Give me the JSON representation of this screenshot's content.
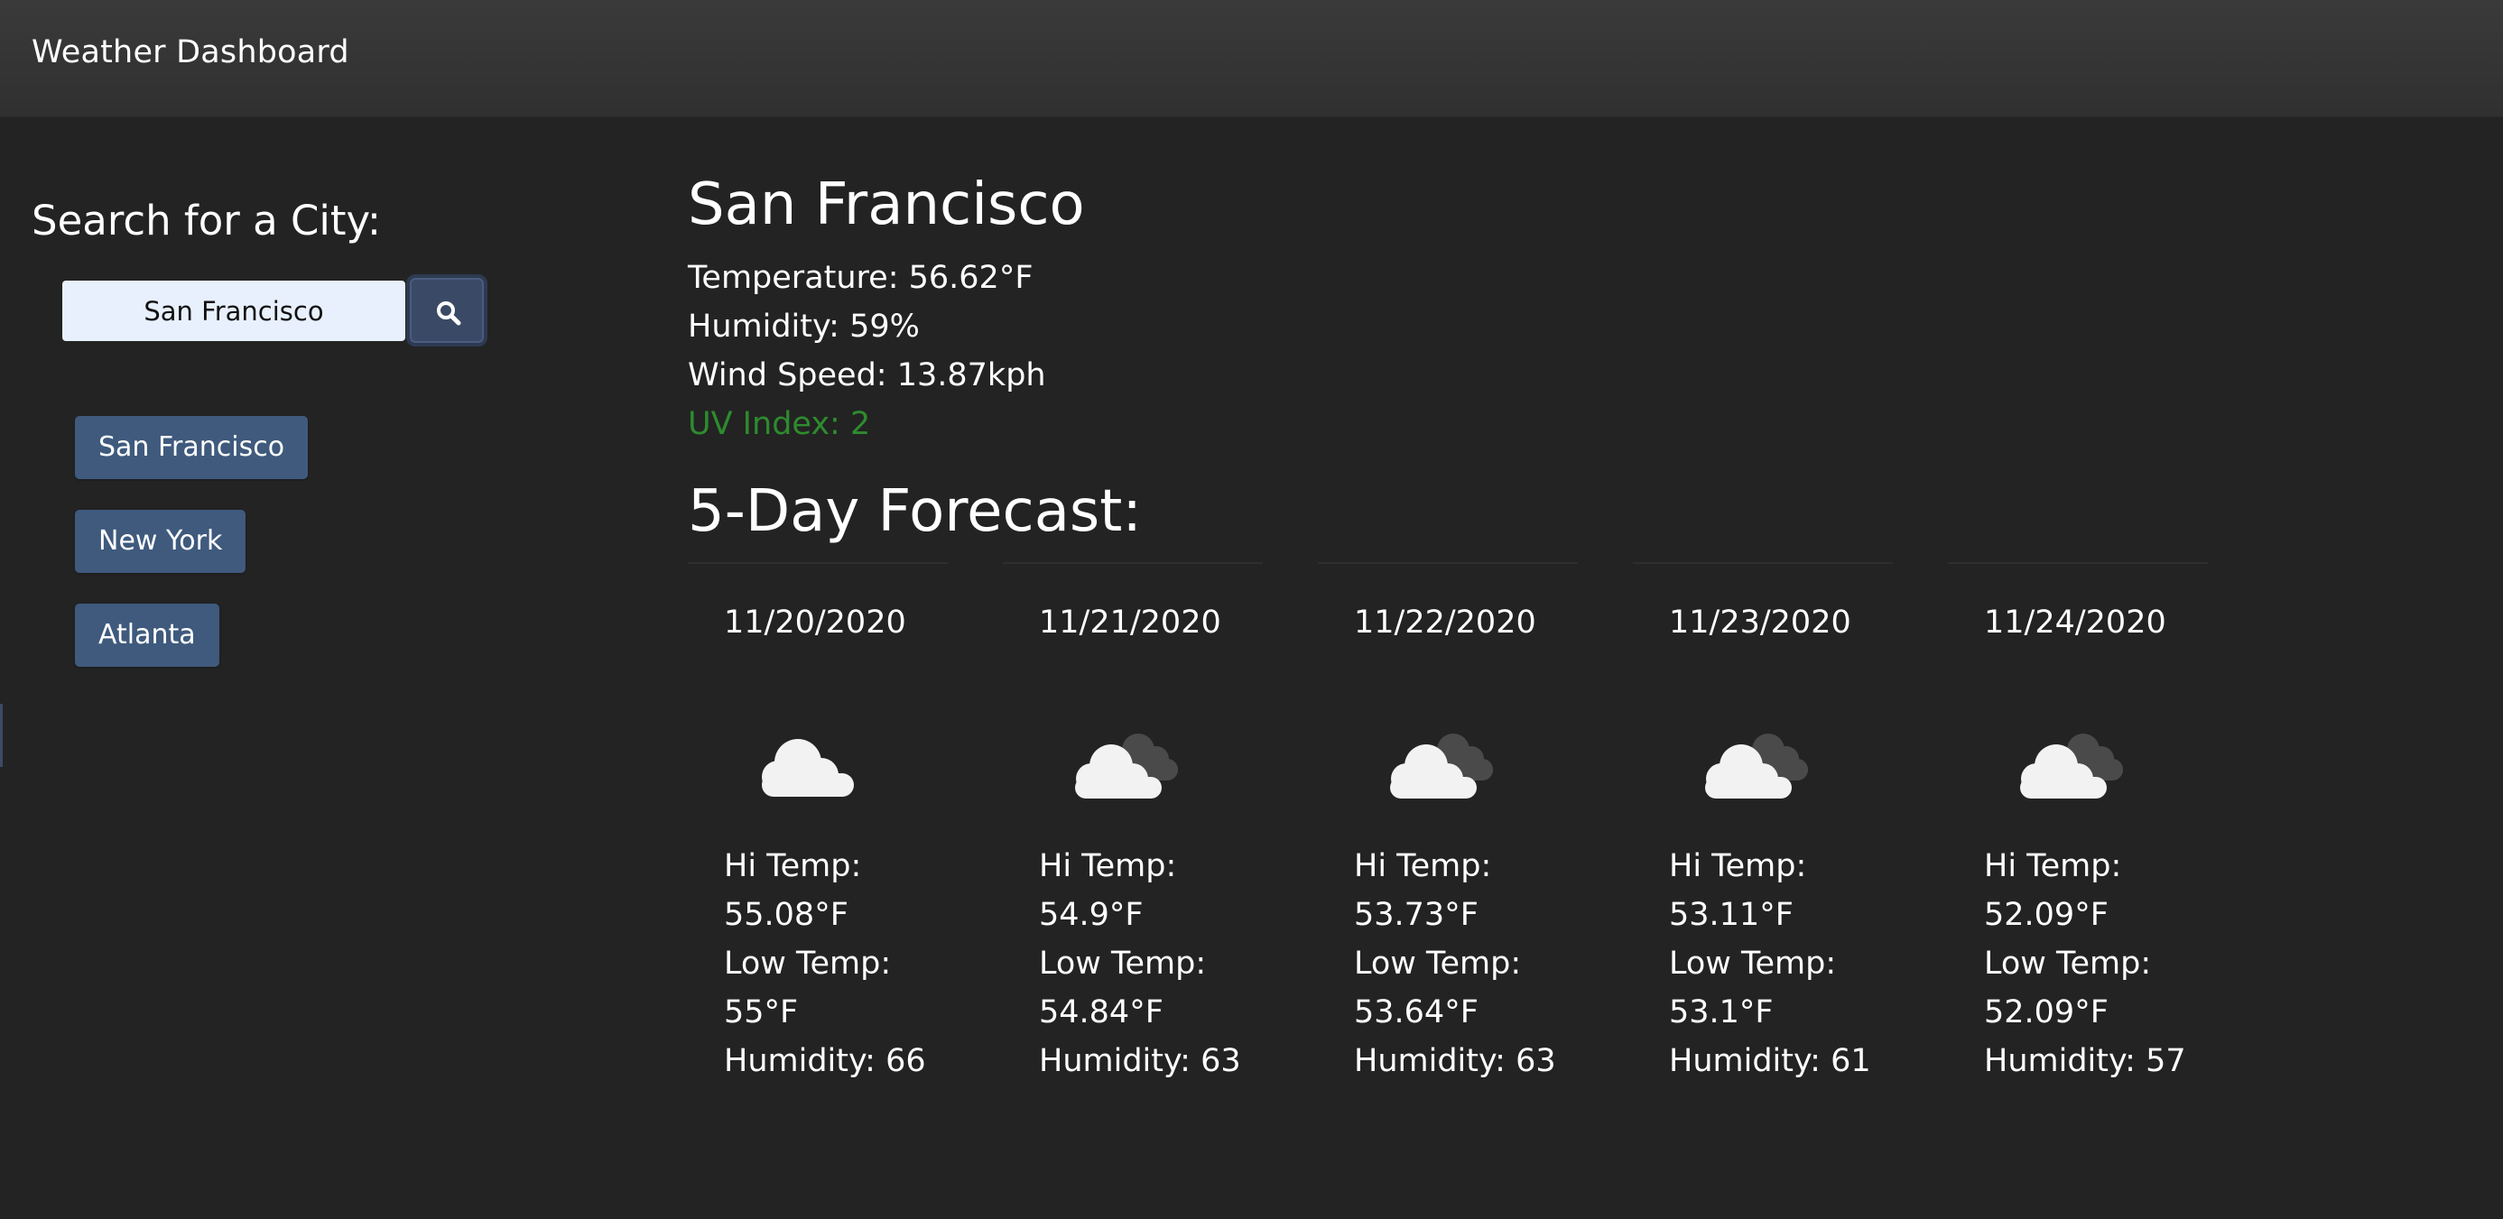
{
  "navbar": {
    "title": "Weather Dashboard"
  },
  "sidebar": {
    "heading": "Search for a City:",
    "search": {
      "value": "San Francisco",
      "placeholder": ""
    },
    "search_button_icon": "search-icon",
    "history": [
      {
        "label": "San Francisco"
      },
      {
        "label": "New York"
      },
      {
        "label": "Atlanta"
      }
    ]
  },
  "current": {
    "city": "San Francisco",
    "temperature": "Temperature: 56.62°F",
    "humidity": "Humidity: 59%",
    "wind": "Wind Speed: 13.87kph",
    "uv": "UV Index: 2",
    "uv_color": "#2e8b2e"
  },
  "forecast": {
    "heading": "5-Day Forecast:",
    "days": [
      {
        "date": "11/20/2020",
        "icon": "cloud-icon",
        "hi_label": "Hi Temp:",
        "hi": "55.08°F",
        "low_label": "Low Temp:",
        "low": "55°F",
        "humidity": "Humidity: 66"
      },
      {
        "date": "11/21/2020",
        "icon": "broken-clouds-icon",
        "hi_label": "Hi Temp:",
        "hi": "54.9°F",
        "low_label": "Low Temp:",
        "low": "54.84°F",
        "humidity": "Humidity: 63"
      },
      {
        "date": "11/22/2020",
        "icon": "broken-clouds-icon",
        "hi_label": "Hi Temp:",
        "hi": "53.73°F",
        "low_label": "Low Temp:",
        "low": "53.64°F",
        "humidity": "Humidity: 63"
      },
      {
        "date": "11/23/2020",
        "icon": "broken-clouds-icon",
        "hi_label": "Hi Temp:",
        "hi": "53.11°F",
        "low_label": "Low Temp:",
        "low": "53.1°F",
        "humidity": "Humidity: 61"
      },
      {
        "date": "11/24/2020",
        "icon": "broken-clouds-icon",
        "hi_label": "Hi Temp:",
        "hi": "52.09°F",
        "low_label": "Low Temp:",
        "low": "52.09°F",
        "humidity": "Humidity: 57"
      }
    ]
  }
}
